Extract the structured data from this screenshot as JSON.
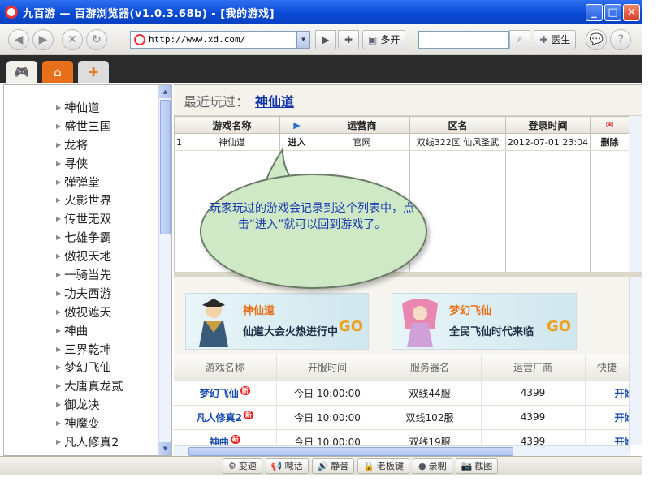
{
  "window": {
    "title": "九百游 — 百游浏览器(v1.0.3.68b) - [我的游戏]",
    "minimize": "_",
    "maximize": "□",
    "close": "✕"
  },
  "toolbar": {
    "address": "http://www.xd.com/",
    "multi_open_label": "多开",
    "doctor_label": "医生",
    "search_placeholder": ""
  },
  "tabs": [
    {
      "icon": "gamepad-icon"
    },
    {
      "icon": "home-icon"
    },
    {
      "icon": "new-tab-icon"
    }
  ],
  "sidebar": {
    "games": [
      "神仙道",
      "盛世三国",
      "龙将",
      "寻侠",
      "弹弹堂",
      "火影世界",
      "传世无双",
      "七雄争霸",
      "傲视天地",
      "一骑当先",
      "功夫西游",
      "傲视遮天",
      "神曲",
      "三界乾坤",
      "梦幻飞仙",
      "大唐真龙贰",
      "御龙决",
      "神魔变",
      "凡人修真2"
    ]
  },
  "recent": {
    "label": "最近玩过：",
    "game": "神仙道"
  },
  "history_table": {
    "headers": [
      "游戏名称",
      "",
      "运营商",
      "区名",
      "登录时间",
      ""
    ],
    "rows": [
      {
        "index": "1",
        "name": "神仙道",
        "action": "进入",
        "operator": "官网",
        "zone": "双线322区  仙风圣武",
        "time": "2012-07-01 23:04",
        "delete": "删除"
      }
    ]
  },
  "callout": {
    "text": "玩家玩过的游戏会记录到这个列表中，点击“进入”就可以回到游戏了。"
  },
  "banners": [
    {
      "name": "神仙道",
      "slogan": "仙道大会火热进行中",
      "go": "GO"
    },
    {
      "name": "梦幻飞仙",
      "slogan": "全民飞仙时代来临",
      "go": "GO"
    }
  ],
  "servers_table": {
    "headers": [
      "游戏名称",
      "开服时间",
      "服务器名",
      "运营厂商",
      "快捷"
    ],
    "rows": [
      {
        "name": "梦幻飞仙",
        "badge": "新",
        "time": "今日 10:00:00",
        "server": "双线44服",
        "vendor": "4399",
        "action": "开始"
      },
      {
        "name": "凡人修真2",
        "badge": "新",
        "time": "今日 10:00:00",
        "server": "双线102服",
        "vendor": "4399",
        "action": "开始"
      },
      {
        "name": "神曲",
        "badge": "新",
        "time": "今日 10:00:00",
        "server": "双线19服",
        "vendor": "4399",
        "action": "开始"
      }
    ]
  },
  "statusbar": {
    "items": [
      "变速",
      "喊话",
      "静音",
      "老板键",
      "录制",
      "截图"
    ]
  }
}
